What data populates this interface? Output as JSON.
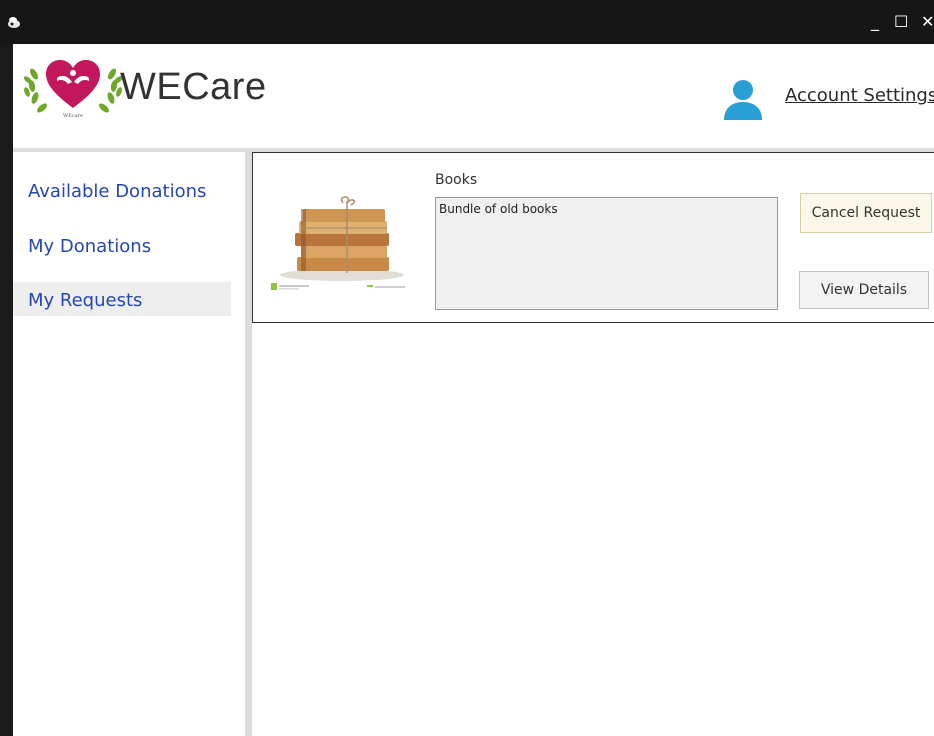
{
  "window": {
    "minimize_glyph": "_",
    "maximize_glyph": "☐",
    "close_glyph": "✕"
  },
  "header": {
    "brand": "WECare",
    "account_settings": "Account Settings"
  },
  "sidebar": {
    "items": [
      {
        "label": "Available Donations"
      },
      {
        "label": "My Donations"
      },
      {
        "label": "My Requests",
        "active": true
      }
    ]
  },
  "requests": [
    {
      "title": "Books",
      "description": "Bundle of old books",
      "cancel_label": "Cancel Request",
      "details_label": "View Details"
    }
  ],
  "colors": {
    "titlebar": "#161616",
    "link": "#2646b0",
    "heart": "#c2185b",
    "avatar": "#2a9fd6"
  }
}
